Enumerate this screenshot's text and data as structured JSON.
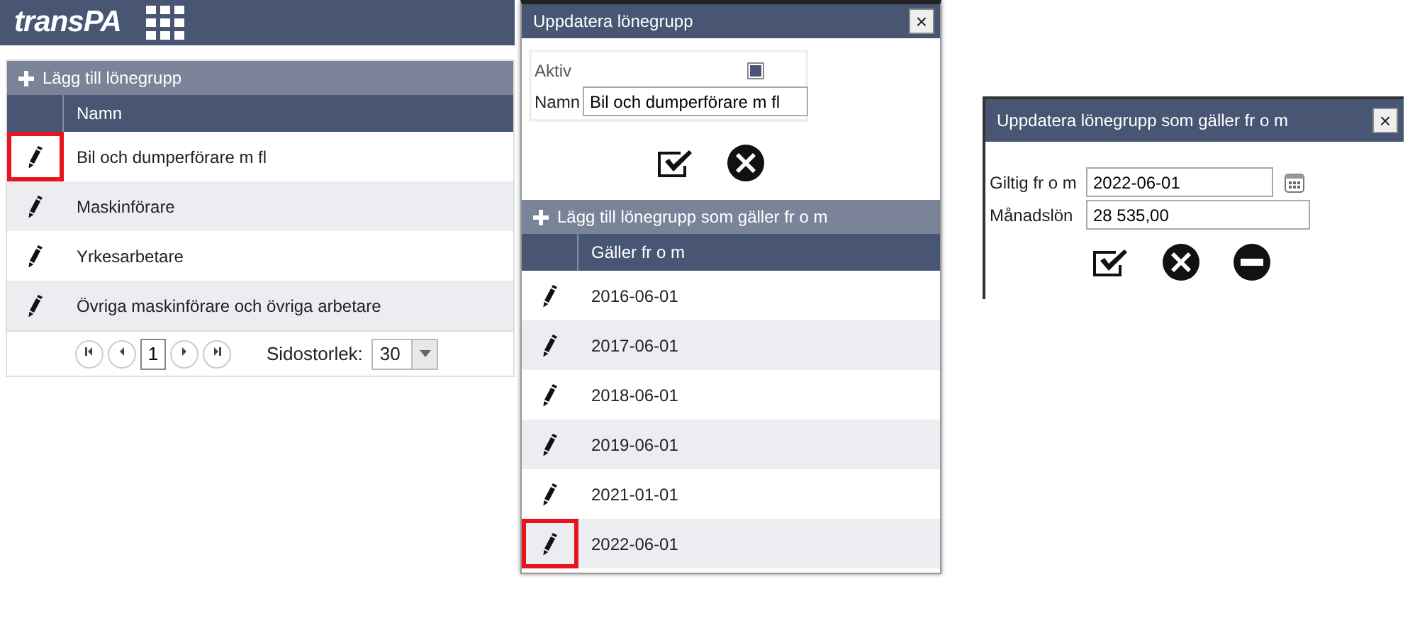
{
  "app": {
    "logo": "transPA"
  },
  "main": {
    "add_button": "Lägg till lönegrupp",
    "columns": [
      "Namn"
    ],
    "rows": [
      {
        "name": "Bil och dumperförare m fl",
        "highlighted": true
      },
      {
        "name": "Maskinförare",
        "highlighted": false
      },
      {
        "name": "Yrkesarbetare",
        "highlighted": false
      },
      {
        "name": "Övriga maskinförare och övriga arbetare",
        "highlighted": false
      }
    ],
    "pager": {
      "pages": [
        {
          "label": "1",
          "selected": true
        }
      ],
      "page_size_label": "Sidostorlek:",
      "page_size": "30"
    }
  },
  "dialog_group": {
    "title": "Uppdatera lönegrupp",
    "close": "×",
    "active_label": "Aktiv",
    "active_checked": true,
    "name_label": "Namn",
    "name_value": "Bil och dumperförare m fl",
    "add_button": "Lägg till lönegrupp som gäller fr o m",
    "columns": [
      "Gäller fr o m"
    ],
    "rows": [
      {
        "date": "2016-06-01",
        "highlighted": false
      },
      {
        "date": "2017-06-01",
        "highlighted": false
      },
      {
        "date": "2018-06-01",
        "highlighted": false
      },
      {
        "date": "2019-06-01",
        "highlighted": false
      },
      {
        "date": "2021-01-01",
        "highlighted": false
      },
      {
        "date": "2022-06-01",
        "highlighted": true
      }
    ]
  },
  "dialog_period": {
    "title": "Uppdatera lönegrupp som gäller fr o m",
    "close": "×",
    "fields": [
      {
        "label": "Giltig fr o m",
        "value": "2022-06-01",
        "kind": "date"
      },
      {
        "label": "Månadslön",
        "value": "28 535,00",
        "kind": "text"
      }
    ],
    "delete_button": true
  }
}
